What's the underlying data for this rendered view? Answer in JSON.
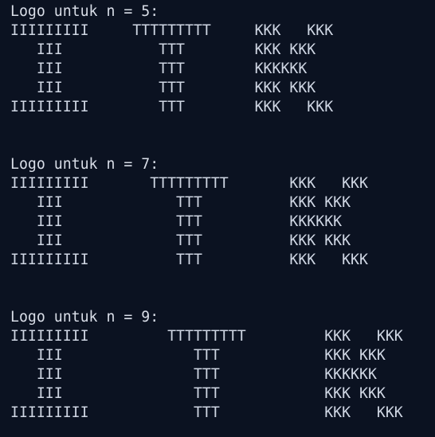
{
  "terminal": {
    "blocks": [
      {
        "heading": "Logo untuk n = 5:",
        "lines": [
          "IIIIIIIII     TTTTTTTTT     KKK   KKK",
          "   III           TTT        KKK KKK",
          "   III           TTT        KKKKKK",
          "   III           TTT        KKK KKK",
          "IIIIIIIII        TTT        KKK   KKK"
        ]
      },
      {
        "heading": "Logo untuk n = 7:",
        "lines": [
          "IIIIIIIII       TTTTTTTTT       KKK   KKK",
          "   III             TTT          KKK KKK",
          "   III             TTT          KKKKKK",
          "   III             TTT          KKK KKK",
          "IIIIIIIII          TTT          KKK   KKK"
        ]
      },
      {
        "heading": "Logo untuk n = 9:",
        "lines": [
          "IIIIIIIII         TTTTTTTTT         KKK   KKK",
          "   III               TTT            KKK KKK",
          "   III               TTT            KKKKKK",
          "   III               TTT            KKK KKK",
          "IIIIIIIII            TTT            KKK   KKK"
        ]
      }
    ]
  }
}
